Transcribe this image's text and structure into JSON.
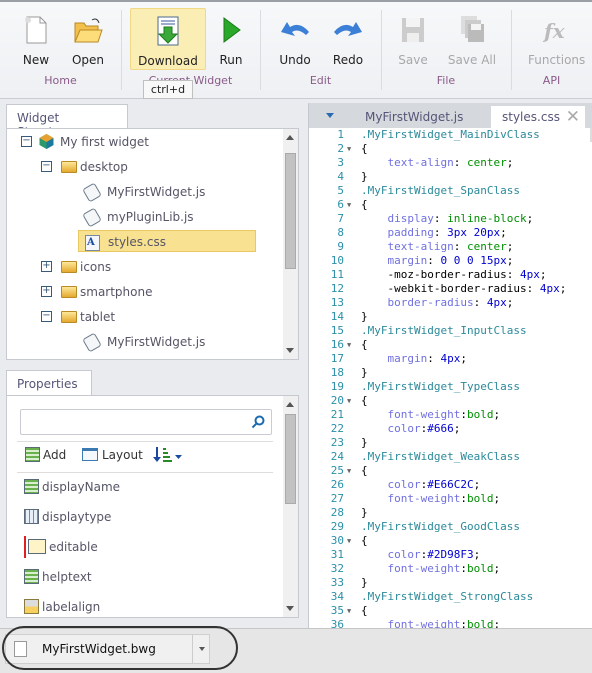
{
  "ribbon": {
    "buttons": [
      {
        "label": "New",
        "icon": "new-file-icon"
      },
      {
        "label": "Open",
        "icon": "open-folder-icon"
      },
      {
        "label": "Download",
        "icon": "download-icon"
      },
      {
        "label": "Run",
        "icon": "play-icon"
      },
      {
        "label": "Undo",
        "icon": "undo-icon"
      },
      {
        "label": "Redo",
        "icon": "redo-icon"
      },
      {
        "label": "Save",
        "icon": "save-icon",
        "disabled": true
      },
      {
        "label": "Save All",
        "icon": "save-all-icon",
        "disabled": true
      },
      {
        "label": "Functions",
        "icon": "fx-icon",
        "disabled": true
      }
    ],
    "groups": [
      "Home",
      "Current Widget",
      "Edit",
      "File",
      "API"
    ],
    "tooltip": "ctrl+d"
  },
  "structure": {
    "tab": "Widget Structure",
    "items": [
      {
        "label": "My first widget",
        "type": "root",
        "expanded": true
      },
      {
        "label": "desktop",
        "type": "folder",
        "expanded": true
      },
      {
        "label": "MyFirstWidget.js",
        "type": "js"
      },
      {
        "label": "myPluginLib.js",
        "type": "js"
      },
      {
        "label": "styles.css",
        "type": "css",
        "selected": true
      },
      {
        "label": "icons",
        "type": "folder",
        "expanded": false
      },
      {
        "label": "smartphone",
        "type": "folder",
        "expanded": false
      },
      {
        "label": "tablet",
        "type": "folder",
        "expanded": true
      },
      {
        "label": "MyFirstWidget.js",
        "type": "js"
      }
    ]
  },
  "properties": {
    "tab": "Properties",
    "search_placeholder": "",
    "add_label": "Add",
    "layout_label": "Layout",
    "items": [
      "displayName",
      "displaytype",
      "editable",
      "helptext",
      "labelalign"
    ]
  },
  "editor": {
    "tabs": [
      {
        "label": "MyFirstWidget.js",
        "active": false
      },
      {
        "label": "styles.css",
        "active": true
      }
    ],
    "lines": [
      [
        [
          "s",
          ".MyFirstWidget_MainDivClass"
        ]
      ],
      [
        [
          "c",
          "{"
        ]
      ],
      [
        [
          "x",
          "    "
        ],
        [
          "p",
          "text-align"
        ],
        [
          "c",
          ": "
        ],
        [
          "k",
          "center"
        ],
        [
          "c",
          ";"
        ]
      ],
      [
        [
          "c",
          "}"
        ]
      ],
      [
        [
          "s",
          ".MyFirstWidget_SpanClass"
        ]
      ],
      [
        [
          "c",
          "{"
        ]
      ],
      [
        [
          "x",
          "    "
        ],
        [
          "p",
          "display"
        ],
        [
          "c",
          ": "
        ],
        [
          "k",
          "inline-block"
        ],
        [
          "c",
          ";"
        ]
      ],
      [
        [
          "x",
          "    "
        ],
        [
          "p",
          "padding"
        ],
        [
          "c",
          ": "
        ],
        [
          "n",
          "3px 20px"
        ],
        [
          "c",
          ";"
        ]
      ],
      [
        [
          "x",
          "    "
        ],
        [
          "p",
          "text-align"
        ],
        [
          "c",
          ": "
        ],
        [
          "k",
          "center"
        ],
        [
          "c",
          ";"
        ]
      ],
      [
        [
          "x",
          "    "
        ],
        [
          "p",
          "margin"
        ],
        [
          "c",
          ": "
        ],
        [
          "n",
          "0 0 0 15px"
        ],
        [
          "c",
          ";"
        ]
      ],
      [
        [
          "x",
          "    "
        ],
        [
          "x",
          "-moz-border-radius"
        ],
        [
          "c",
          ": "
        ],
        [
          "n",
          "4px"
        ],
        [
          "c",
          ";"
        ]
      ],
      [
        [
          "x",
          "    "
        ],
        [
          "x",
          "-webkit-border-radius"
        ],
        [
          "c",
          ": "
        ],
        [
          "n",
          "4px"
        ],
        [
          "c",
          ";"
        ]
      ],
      [
        [
          "x",
          "    "
        ],
        [
          "p",
          "border-radius"
        ],
        [
          "c",
          ": "
        ],
        [
          "n",
          "4px"
        ],
        [
          "c",
          ";"
        ]
      ],
      [
        [
          "c",
          "}"
        ]
      ],
      [
        [
          "s",
          ".MyFirstWidget_InputClass"
        ]
      ],
      [
        [
          "c",
          "{"
        ]
      ],
      [
        [
          "x",
          "    "
        ],
        [
          "p",
          "margin"
        ],
        [
          "c",
          ": "
        ],
        [
          "n",
          "4px"
        ],
        [
          "c",
          ";"
        ]
      ],
      [
        [
          "c",
          "}"
        ]
      ],
      [
        [
          "s",
          ".MyFirstWidget_TypeClass"
        ]
      ],
      [
        [
          "c",
          "{"
        ]
      ],
      [
        [
          "x",
          "    "
        ],
        [
          "p",
          "font-weight"
        ],
        [
          "c",
          ":"
        ],
        [
          "k",
          "bold"
        ],
        [
          "c",
          ";"
        ]
      ],
      [
        [
          "x",
          "    "
        ],
        [
          "p",
          "color"
        ],
        [
          "c",
          ":"
        ],
        [
          "n",
          "#666"
        ],
        [
          "c",
          ";"
        ]
      ],
      [
        [
          "c",
          "}"
        ]
      ],
      [
        [
          "s",
          ".MyFirstWidget_WeakClass"
        ]
      ],
      [
        [
          "c",
          "{"
        ]
      ],
      [
        [
          "x",
          "    "
        ],
        [
          "p",
          "color"
        ],
        [
          "c",
          ":"
        ],
        [
          "n",
          "#E66C2C"
        ],
        [
          "c",
          ";"
        ]
      ],
      [
        [
          "x",
          "    "
        ],
        [
          "p",
          "font-weight"
        ],
        [
          "c",
          ":"
        ],
        [
          "k",
          "bold"
        ],
        [
          "c",
          ";"
        ]
      ],
      [
        [
          "c",
          "}"
        ]
      ],
      [
        [
          "s",
          ".MyFirstWidget_GoodClass"
        ]
      ],
      [
        [
          "c",
          "{"
        ]
      ],
      [
        [
          "x",
          "    "
        ],
        [
          "p",
          "color"
        ],
        [
          "c",
          ":"
        ],
        [
          "n",
          "#2D98F3"
        ],
        [
          "c",
          ";"
        ]
      ],
      [
        [
          "x",
          "    "
        ],
        [
          "p",
          "font-weight"
        ],
        [
          "c",
          ":"
        ],
        [
          "k",
          "bold"
        ],
        [
          "c",
          ";"
        ]
      ],
      [
        [
          "c",
          "}"
        ]
      ],
      [
        [
          "s",
          ".MyFirstWidget_StrongClass"
        ]
      ],
      [
        [
          "c",
          "{"
        ]
      ],
      [
        [
          "x",
          "    "
        ],
        [
          "p",
          "font-weight"
        ],
        [
          "c",
          ":"
        ],
        [
          "k",
          "bold"
        ],
        [
          "c",
          ";"
        ]
      ]
    ]
  },
  "bottom": {
    "file_label": "MyFirstWidget.bwg"
  },
  "colors": {
    "accent_highlight": "#fbeeb5",
    "group_label": "#8a5a8a",
    "selected_item": "#f8e190"
  }
}
